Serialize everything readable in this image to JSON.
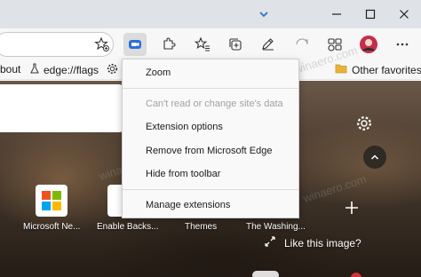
{
  "titlebar": {
    "icons": [
      "chevron-down-icon",
      "minimize-icon",
      "maximize-icon",
      "close-icon"
    ]
  },
  "toolbar": {
    "icons": [
      "star-add-icon",
      "zoom-extension-icon",
      "puzzle-extensions-icon",
      "favorites-icon",
      "collections-icon",
      "edit-icon",
      "share-icon",
      "games-icon",
      "profile-avatar"
    ]
  },
  "favorites_bar": {
    "items": [
      {
        "label": "bout",
        "icon": ""
      },
      {
        "label": "edge://flags",
        "icon": "flask-icon"
      },
      {
        "label": "",
        "icon": "gear-icon"
      }
    ],
    "other_favorites": "Other favorites"
  },
  "menu": {
    "items": [
      {
        "label": "Zoom",
        "enabled": true
      },
      {
        "label": "Can't read or change site's data",
        "enabled": false
      },
      {
        "label": "Extension options",
        "enabled": true
      },
      {
        "label": "Remove from Microsoft Edge",
        "enabled": true
      },
      {
        "label": "Hide from toolbar",
        "enabled": true
      },
      {
        "label": "Manage extensions",
        "enabled": true
      }
    ]
  },
  "new_tab": {
    "tiles": [
      {
        "label": "Microsoft Ne..."
      },
      {
        "label": "Enable Backs..."
      },
      {
        "label": "Themes"
      },
      {
        "label": "The Washing..."
      }
    ],
    "like_text": "Like this image?"
  },
  "watermark": "winaero.com",
  "colors": {
    "titlebar": "#dfe2e7",
    "toolbar": "#f7f7f7",
    "accent": "#2b6fd8",
    "folder": "#e8b33a",
    "close_red": "#d13438"
  }
}
